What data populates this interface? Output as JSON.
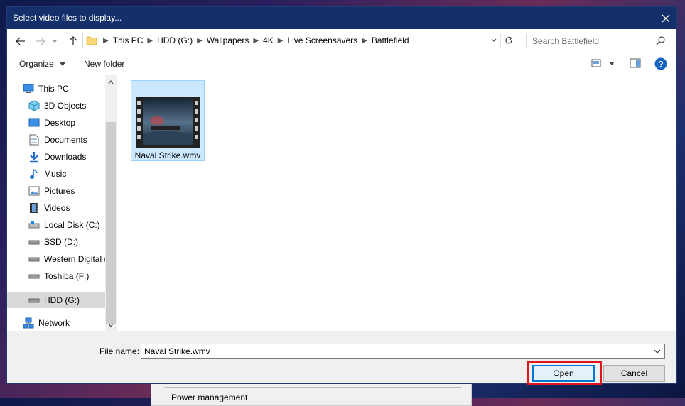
{
  "dialog": {
    "title": "Select video files to display..."
  },
  "nav": {
    "breadcrumbs": [
      "This PC",
      "HDD (G:)",
      "Wallpapers",
      "4K",
      "Live Screensavers",
      "Battlefield"
    ],
    "search_placeholder": "Search Battlefield"
  },
  "toolbar": {
    "organize": "Organize",
    "new_folder": "New folder"
  },
  "sidebar": {
    "items": [
      {
        "label": "This PC",
        "icon": "computer-icon"
      },
      {
        "label": "3D Objects",
        "icon": "cube-icon"
      },
      {
        "label": "Desktop",
        "icon": "desktop-icon"
      },
      {
        "label": "Documents",
        "icon": "document-icon"
      },
      {
        "label": "Downloads",
        "icon": "download-icon"
      },
      {
        "label": "Music",
        "icon": "music-icon"
      },
      {
        "label": "Pictures",
        "icon": "pictures-icon"
      },
      {
        "label": "Videos",
        "icon": "videos-icon"
      },
      {
        "label": "Local Disk (C:)",
        "icon": "drive-icon"
      },
      {
        "label": "SSD (D:)",
        "icon": "drive-icon"
      },
      {
        "label": "Western Digital (",
        "icon": "drive-icon"
      },
      {
        "label": "Toshiba (F:)",
        "icon": "drive-icon"
      },
      {
        "label": "HDD (G:)",
        "icon": "drive-icon",
        "selected": true
      },
      {
        "label": "Network",
        "icon": "network-icon"
      }
    ]
  },
  "files": [
    {
      "name": "Naval Strike.wmv",
      "selected": true
    }
  ],
  "footer": {
    "file_name_label": "File name:",
    "file_name_value": "Naval Strike.wmv",
    "open": "Open",
    "cancel": "Cancel"
  },
  "background": {
    "partial_label": "Power management"
  },
  "colors": {
    "titlebar": "#14306b",
    "selection": "#cce8ff",
    "highlight": "#e0151c",
    "accent": "#0078d7"
  }
}
